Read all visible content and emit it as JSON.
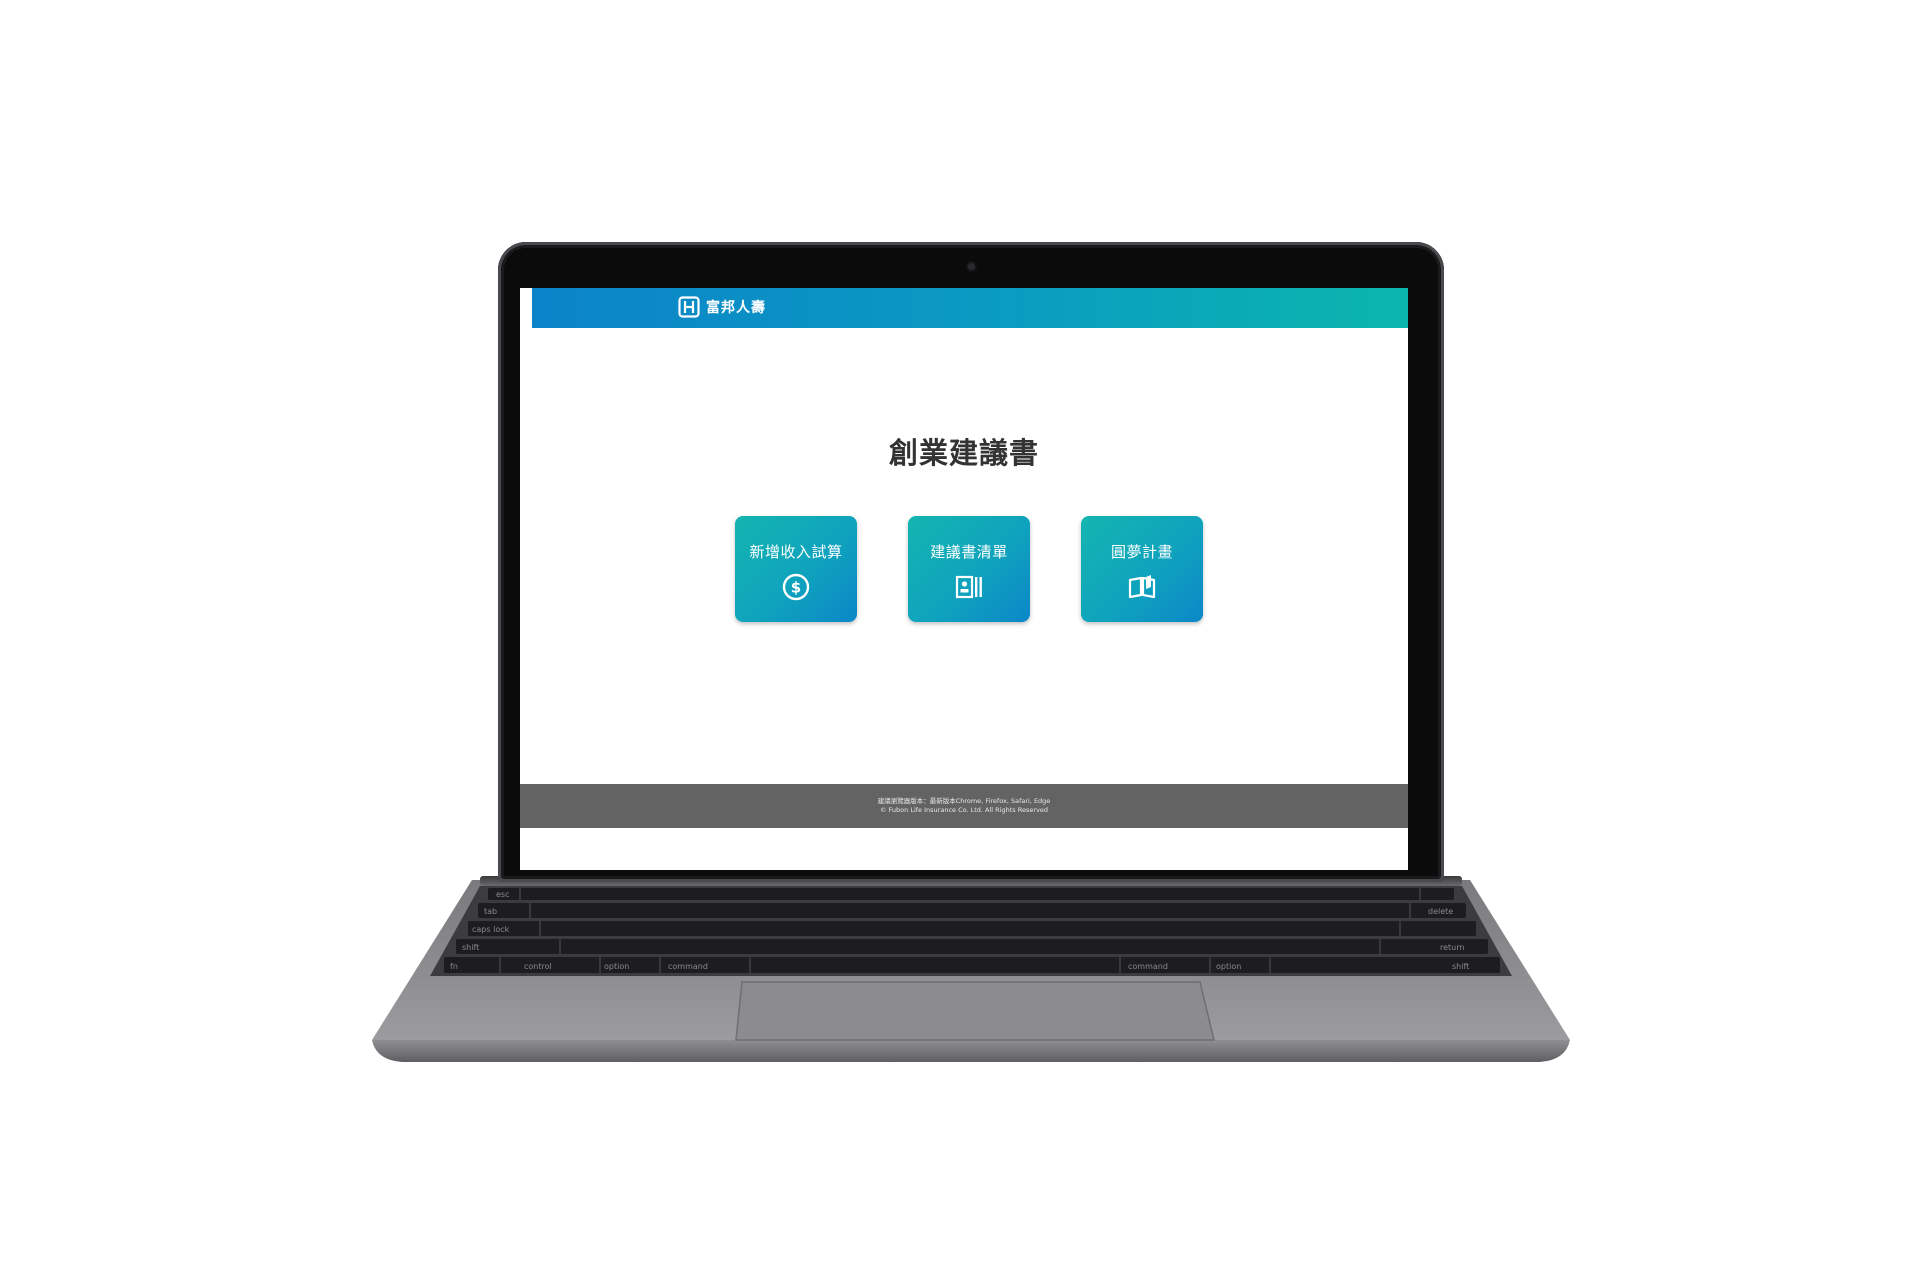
{
  "brand": {
    "name": "富邦人壽",
    "logo_icon": "fubon-logo-icon"
  },
  "page": {
    "title": "創業建議書"
  },
  "tiles": [
    {
      "label": "新增收入試算",
      "icon": "dollar-circle-icon"
    },
    {
      "label": "建議書清單",
      "icon": "document-list-icon"
    },
    {
      "label": "圓夢計畫",
      "icon": "open-book-icon"
    }
  ],
  "footer": {
    "browser_note": "建議瀏覽器版本：最新版本Chrome, Firefox, Safari, Edge",
    "copyright": "© Fubon Life Insurance Co. Ltd. All Rights Reserved"
  },
  "keyboard": {
    "labels": [
      "esc",
      "tab",
      "caps lock",
      "shift",
      "fn",
      "control",
      "option",
      "command",
      "command",
      "option",
      "delete",
      "return",
      "shift"
    ]
  },
  "colors": {
    "header_start": "#0b83c9",
    "header_end": "#0bb6ad",
    "tile_start": "#14b5b0",
    "tile_end": "#0c87c8",
    "footer_bg": "#636363"
  }
}
